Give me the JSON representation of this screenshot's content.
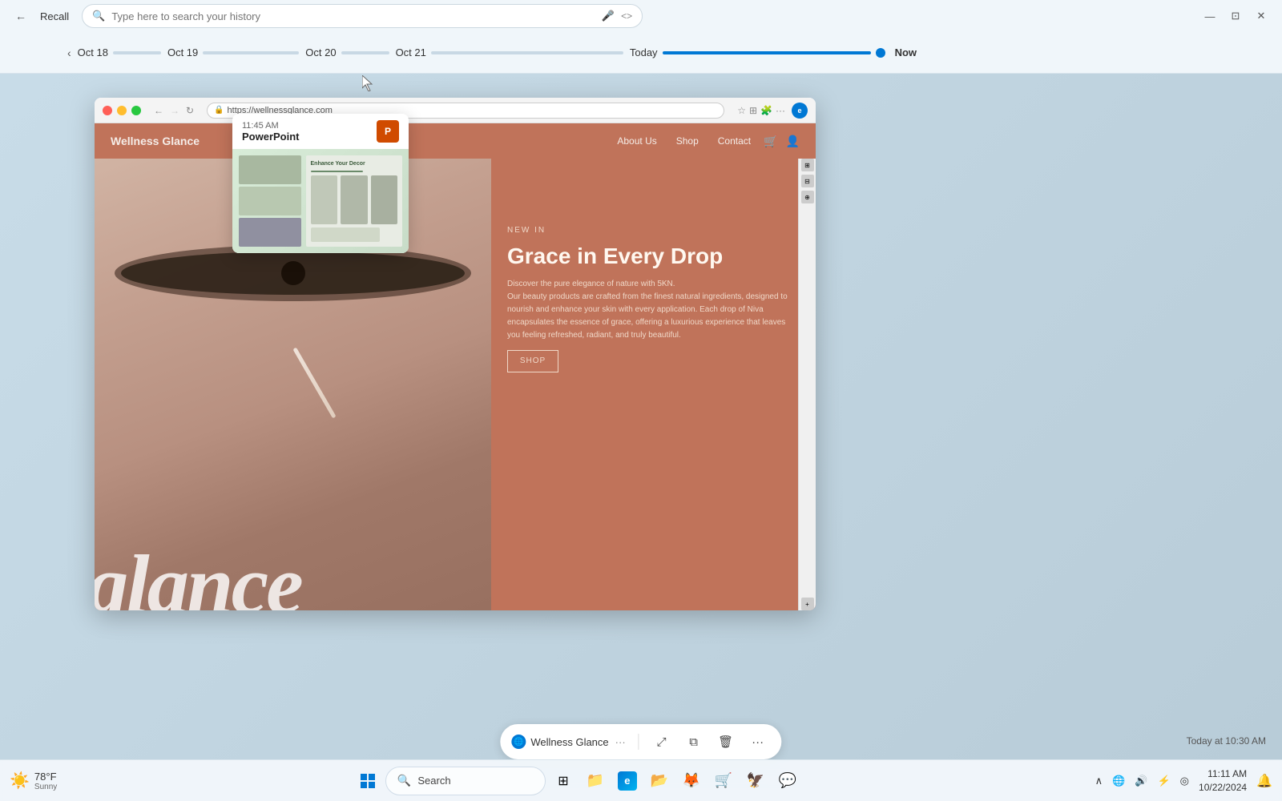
{
  "titlebar": {
    "back_label": "←",
    "app_name": "Recall",
    "search_placeholder": "Type here to search your history",
    "minimize": "—",
    "maximize": "⊡",
    "close": "✕",
    "mic_icon": "🎤",
    "code_icon": "<>"
  },
  "timeline": {
    "nav_back": "‹",
    "dates": [
      "Oct 18",
      "Oct 19",
      "Oct 20",
      "Oct 21",
      "Today",
      "Now"
    ],
    "bars": [
      60,
      120,
      60,
      240,
      260,
      0
    ]
  },
  "browser": {
    "address": "https://wellnessglance.com",
    "tab_title": "Wellness Glance"
  },
  "website": {
    "nav_links": [
      "About Us",
      "Shop",
      "Contact"
    ],
    "badge": "NEW IN",
    "title": "Grace in Every Drop",
    "description": "Discover the pure elegance of nature with 5KN.\nOur beauty products are crafted from the finest natural ingredients, designed to nourish and enhance your skin with every application. Each drop of Niva encapsulates the essence of grace, offering a luxurious experience that leaves you feeling refreshed, radiant, and truly beautiful.",
    "shop_btn": "SHOP",
    "glance_text": "glance"
  },
  "ppt_popup": {
    "time": "11:45 AM",
    "app_name": "PowerPoint",
    "app_short": "P",
    "slide_title": "Enhance Your Decor"
  },
  "action_bar": {
    "app_icon": "🌐",
    "app_name": "Wellness Glance",
    "dots": "···",
    "expand_icon": "⤢",
    "copy_icon": "⧉",
    "delete_icon": "🗑",
    "more_icon": "···",
    "timestamp": "Today at 10:30 AM"
  },
  "taskbar": {
    "weather_temp": "78°F",
    "weather_cond": "Sunny",
    "search_label": "Search",
    "clock_time": "11:11 AM",
    "clock_date": "10/22/2024",
    "taskbar_icons": [
      "⊞",
      "🔍",
      "📁",
      "🌐",
      "📂",
      "🦊",
      "🛒",
      "🦅",
      "💬"
    ],
    "sys_icons": [
      "🔔",
      "🌐",
      "🔊",
      "⚡",
      "📶",
      "🔔"
    ]
  }
}
